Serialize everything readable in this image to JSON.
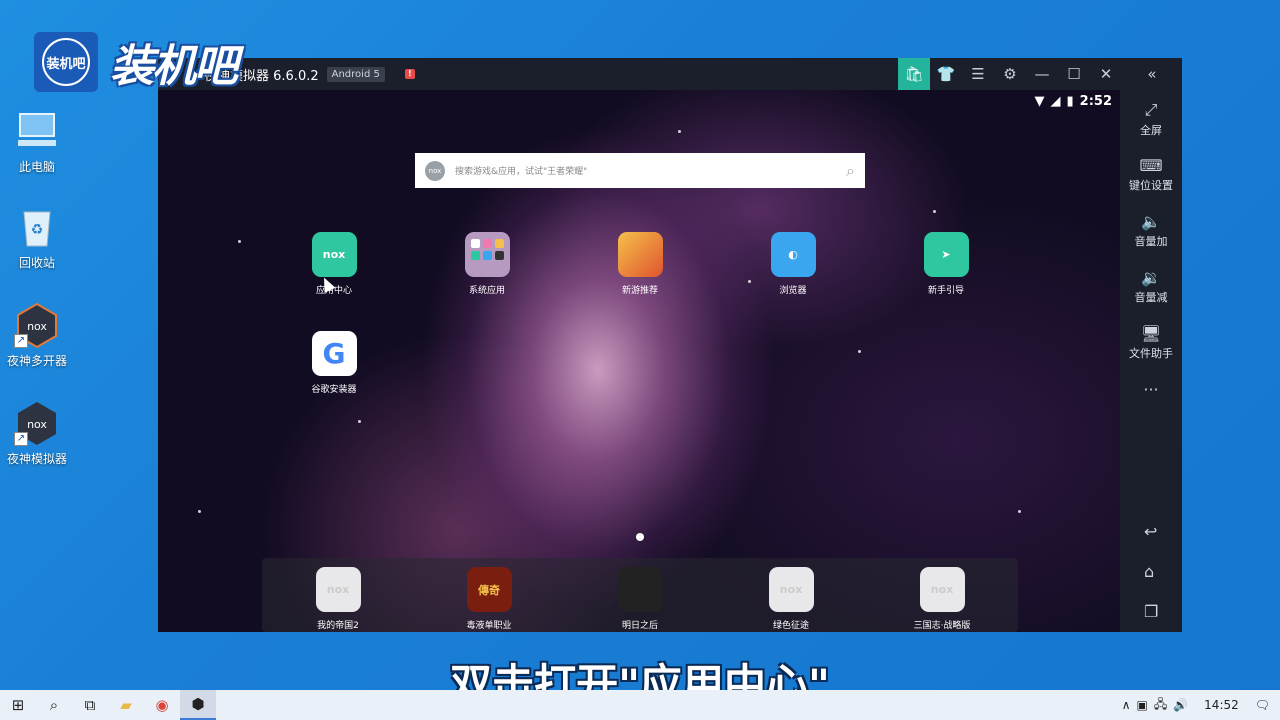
{
  "watermark": {
    "logo_text": "装机吧",
    "brand": "装机吧"
  },
  "desktop": {
    "icons": [
      {
        "label": "此电脑"
      },
      {
        "label": "回收站"
      },
      {
        "label": "夜神多开器"
      },
      {
        "label": "夜神模拟器"
      }
    ]
  },
  "emulator": {
    "title": "夜神模拟器 6.6.0.2",
    "android_badge": "Android 5",
    "status_time": "2:52",
    "search_placeholder": "搜索游戏&应用，试试\"王者荣耀\"",
    "search_logo": "nox",
    "apps": [
      {
        "label": "应用中心",
        "icon_text": "nox",
        "color": "#2fc7a0"
      },
      {
        "label": "系统应用",
        "icon_text": "",
        "color": "#b79ac0"
      },
      {
        "label": "新游推荐",
        "icon_text": "",
        "color": "#e7a53a"
      },
      {
        "label": "浏览器",
        "icon_text": "",
        "color": "#3aa6f0"
      },
      {
        "label": "新手引导",
        "icon_text": "",
        "color": "#2fc7a0"
      },
      {
        "label": "谷歌安装器",
        "icon_text": "G",
        "color": "#ffffff"
      }
    ],
    "dock": [
      {
        "label": "我的帝国2",
        "icon_text": "nox"
      },
      {
        "label": "毒液单职业",
        "icon_text": "傳奇"
      },
      {
        "label": "明日之后",
        "icon_text": ""
      },
      {
        "label": "绿色征途",
        "icon_text": "nox"
      },
      {
        "label": "三国志·战略版",
        "icon_text": "nox"
      }
    ],
    "sidebar": [
      {
        "label": "全屏",
        "glyph": "⤢"
      },
      {
        "label": "键位设置",
        "glyph": "⌨"
      },
      {
        "label": "音量加",
        "glyph": "🔈"
      },
      {
        "label": "音量减",
        "glyph": "🔉"
      },
      {
        "label": "文件助手",
        "glyph": "🖥"
      },
      {
        "label": "",
        "glyph": "···"
      }
    ]
  },
  "subtitle": "双击打开\"应用中心\"",
  "taskbar": {
    "time": "14:52"
  }
}
